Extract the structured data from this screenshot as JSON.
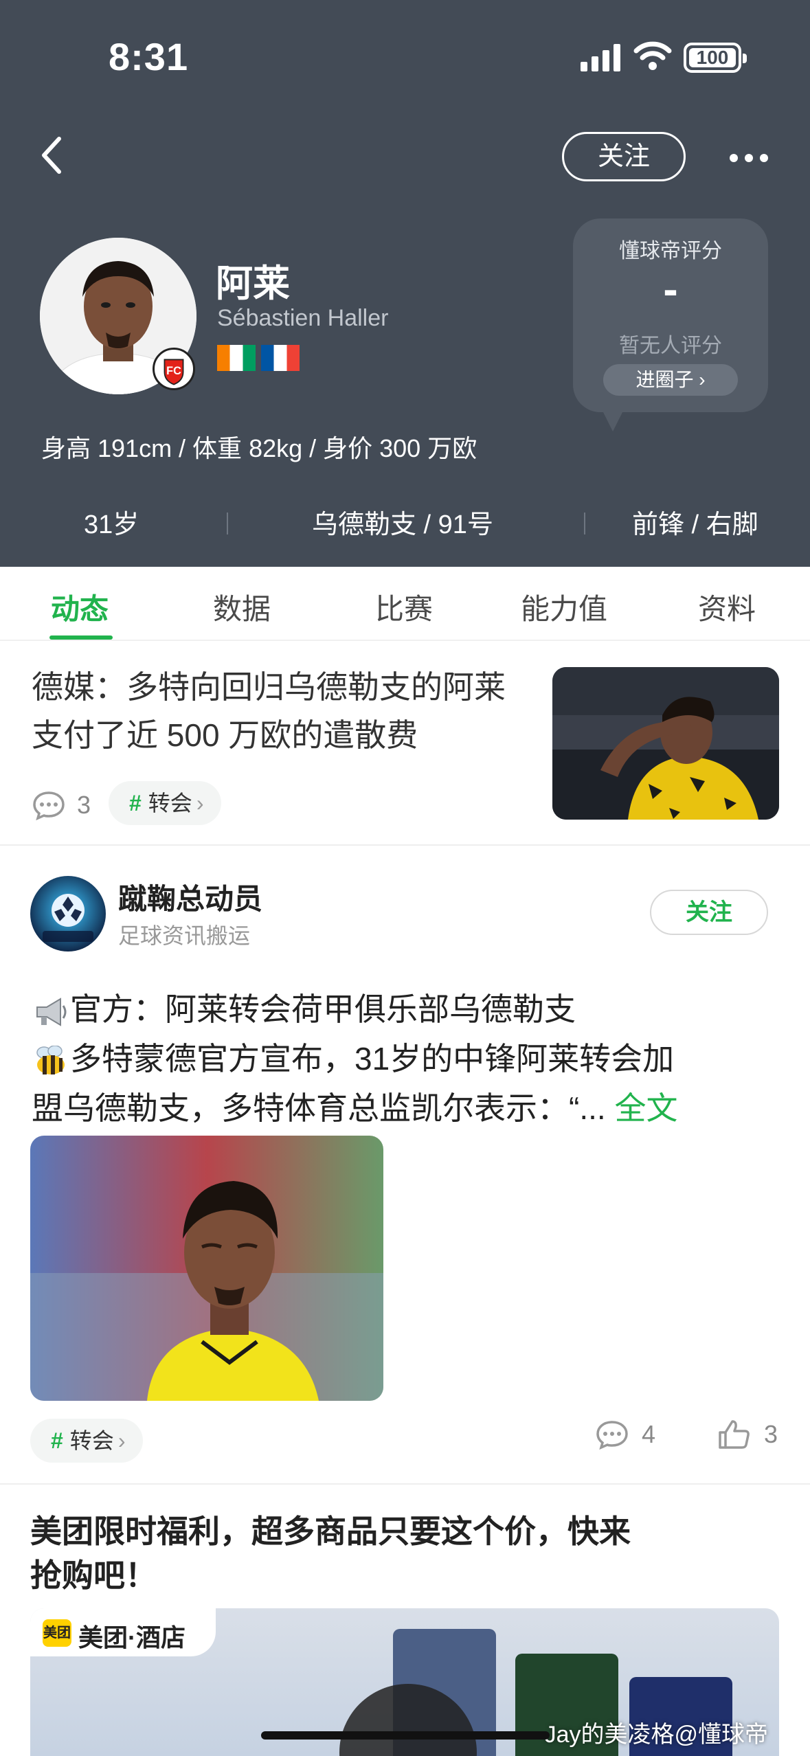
{
  "status_bar": {
    "time": "8:31",
    "battery": "100"
  },
  "header": {
    "follow_label": "关注",
    "player": {
      "name": "阿莱",
      "latin_name": "Sébastien Haller",
      "nationalities": [
        "Côte d'Ivoire",
        "France"
      ]
    },
    "rating": {
      "title": "懂球帝评分",
      "value": "-",
      "note": "暂无人评分",
      "button": "进圈子 ›"
    },
    "stats_line": "身高 191cm / 体重 82kg / 身价 300 万欧",
    "info": {
      "age": "31岁",
      "club": "乌德勒支 / 91号",
      "position": "前锋 / 右脚"
    }
  },
  "tabs": [
    {
      "label": "动态",
      "active": true
    },
    {
      "label": "数据",
      "active": false
    },
    {
      "label": "比赛",
      "active": false
    },
    {
      "label": "能力值",
      "active": false
    },
    {
      "label": "资料",
      "active": false
    }
  ],
  "news": {
    "title": "德媒：多特向回归乌德勒支的阿莱支付了近 500 万欧的遣散费",
    "comments": "3",
    "tag": "转会"
  },
  "post": {
    "author": "蹴鞠总动员",
    "subtitle": "足球资讯搬运",
    "follow_label": "关注",
    "line1": "官方：阿莱转会荷甲俱乐部乌德勒支",
    "line2": "多特蒙德官方宣布，31岁的中锋阿莱转会加",
    "line3": "盟乌德勒支，多特体育总监凯尔表示：“...",
    "fulltext": "全文",
    "tag": "转会",
    "comments": "4",
    "likes": "3"
  },
  "ad": {
    "title_line1": "美团限时福利，超多商品只要这个价，快来",
    "title_line2": "抢购吧！",
    "logo_mark": "美团",
    "logo_text": "美团·酒店",
    "watermark": "Jay的美凌格@懂球帝"
  },
  "colors": {
    "header_bg": "#434b56",
    "accent_green": "#21b34d"
  },
  "icons": [
    "back-arrow-icon",
    "more-icon",
    "signal-icon",
    "wifi-icon",
    "battery-icon",
    "comment-icon",
    "like-icon",
    "hashtag-icon",
    "megaphone-icon",
    "bee-icon"
  ]
}
